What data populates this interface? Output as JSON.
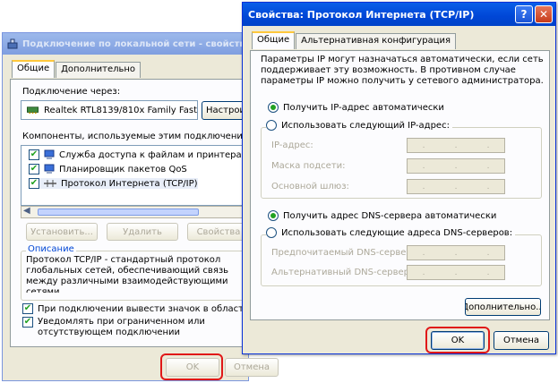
{
  "back_window": {
    "title": "Подключение по локальной сети - свойства",
    "tabs": [
      "Общие",
      "Дополнительно"
    ],
    "connect_via_label": "Подключение через:",
    "adapter_name": "Realtek RTL8139/810x Family Fast",
    "configure_button": "Настроить...",
    "components_label": "Компоненты, используемые этим подключением:",
    "components": [
      {
        "label": "Служба доступа к файлам и принтерам сетей Microsoft",
        "checked": true
      },
      {
        "label": "Планировщик пакетов QoS",
        "checked": true
      },
      {
        "label": "Протокол Интернета (TCP/IP)",
        "checked": true
      }
    ],
    "install_button": "Установить...",
    "remove_button": "Удалить",
    "properties_button": "Свойства",
    "description_title": "Описание",
    "description_text": "Протокол TCP/IP - стандартный протокол глобальных сетей, обеспечивающий связь между различными взаимодействующими сетями.",
    "show_icon_label": "При подключении вывести значок в области уведомлений",
    "notify_label": "Уведомлять при ограниченном или отсутствующем подключении",
    "ok_button": "OK",
    "cancel_button": "Отмена"
  },
  "front_window": {
    "title": "Свойства: Протокол Интернета (TCP/IP)",
    "help_glyph": "?",
    "close_glyph": "✕",
    "tabs": [
      "Общие",
      "Альтернативная конфигурация"
    ],
    "intro_text": "Параметры IP могут назначаться автоматически, если сеть поддерживает эту возможность. В противном случае параметры IP можно получить у сетевого администратора.",
    "ip_auto_label": "Получить IP-адрес автоматически",
    "ip_manual_label": "Использовать следующий IP-адрес:",
    "ip_address_label": "IP-адрес:",
    "subnet_label": "Маска подсети:",
    "gateway_label": "Основной шлюз:",
    "dns_auto_label": "Получить адрес DNS-сервера автоматически",
    "dns_manual_label": "Использовать следующие адреса DNS-серверов:",
    "dns_preferred_label": "Предпочитаемый DNS-сервер:",
    "dns_alternate_label": "Альтернативный DNS-сервер:",
    "advanced_button": "Дополнительно...",
    "ok_button": "OK",
    "cancel_button": "Отмена"
  },
  "colors": {
    "highlight_ring": "#e01818",
    "title_active": "#0046d6",
    "title_inactive": "#7f9ee0",
    "dialog_face": "#ece9d8"
  }
}
